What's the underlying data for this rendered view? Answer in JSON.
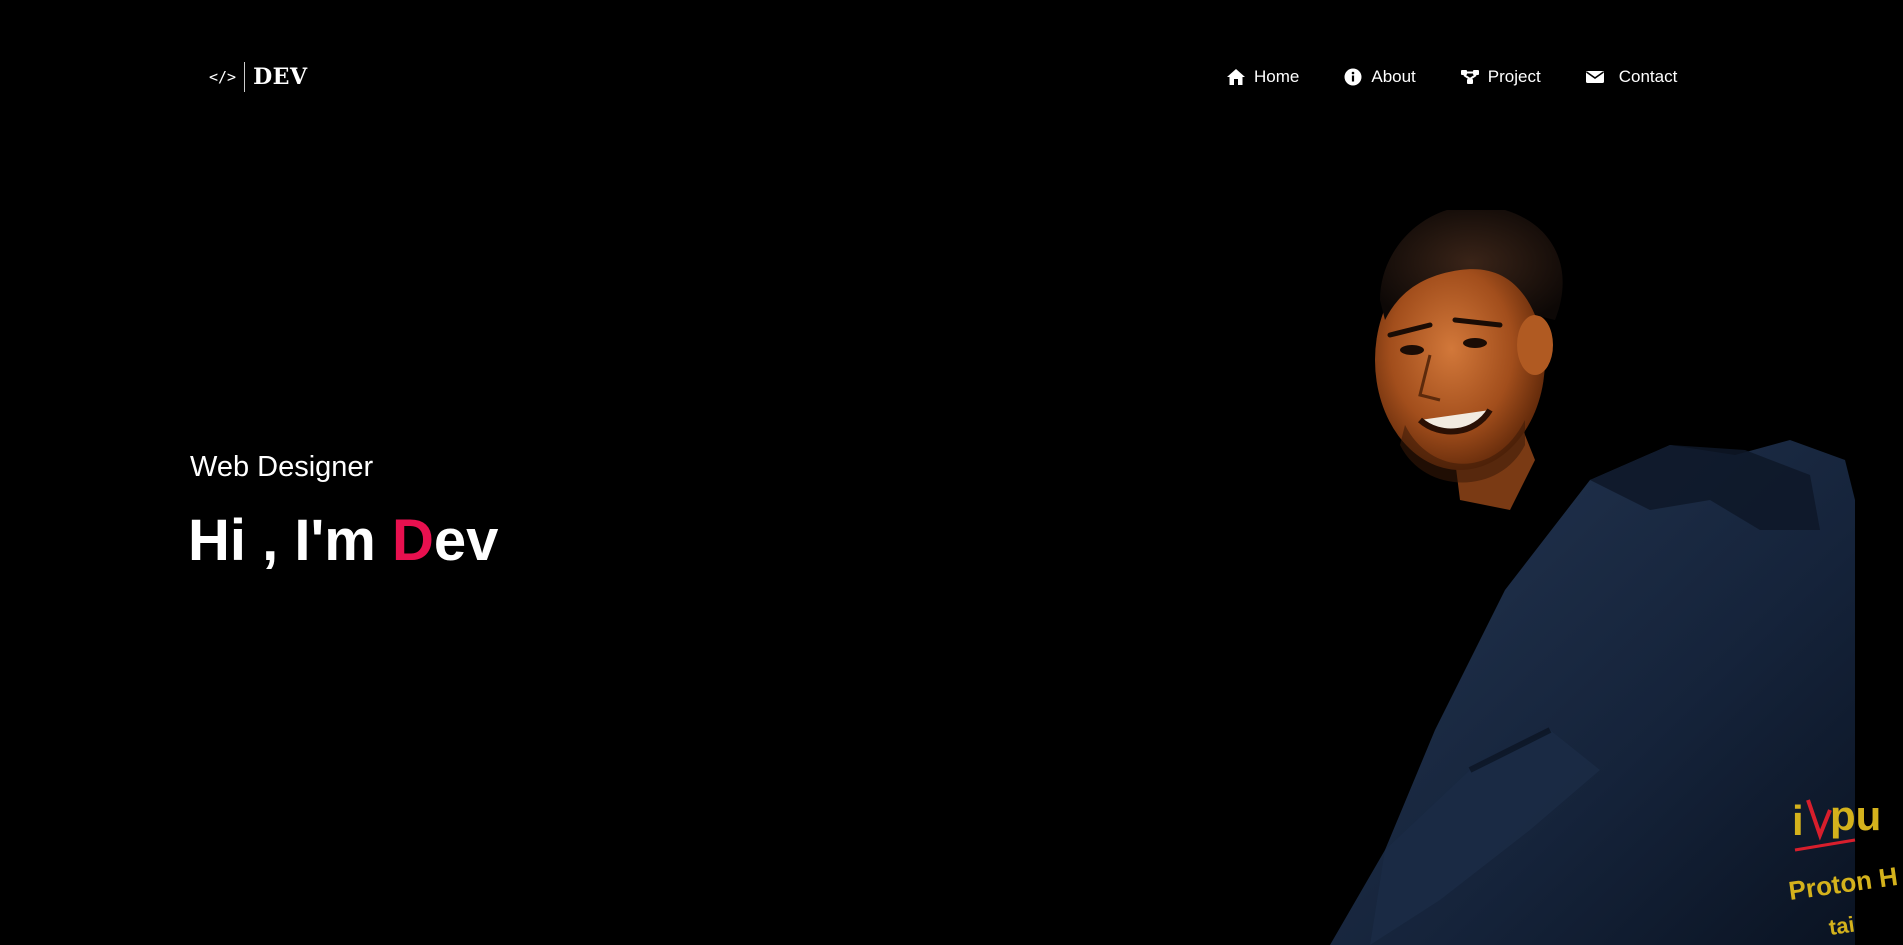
{
  "logo": {
    "code_symbol": "</>",
    "text": "DEV"
  },
  "nav": {
    "items": [
      {
        "label": "Home",
        "icon": "home-icon"
      },
      {
        "label": "About",
        "icon": "info-icon"
      },
      {
        "label": "Project",
        "icon": "project-icon"
      },
      {
        "label": "Contact",
        "icon": "envelope-icon"
      }
    ]
  },
  "hero": {
    "role": "Web Designer",
    "greeting": "Hi , I'm ",
    "name_first_letter": "D",
    "name_rest": "ev"
  },
  "portrait": {
    "hoodie_text_1": "i",
    "hoodie_text_2": "pu",
    "hoodie_text_3": "Proton H",
    "hoodie_text_4": "tai"
  },
  "colors": {
    "background": "#000000",
    "text": "#ffffff",
    "accent": "#e8104f"
  }
}
